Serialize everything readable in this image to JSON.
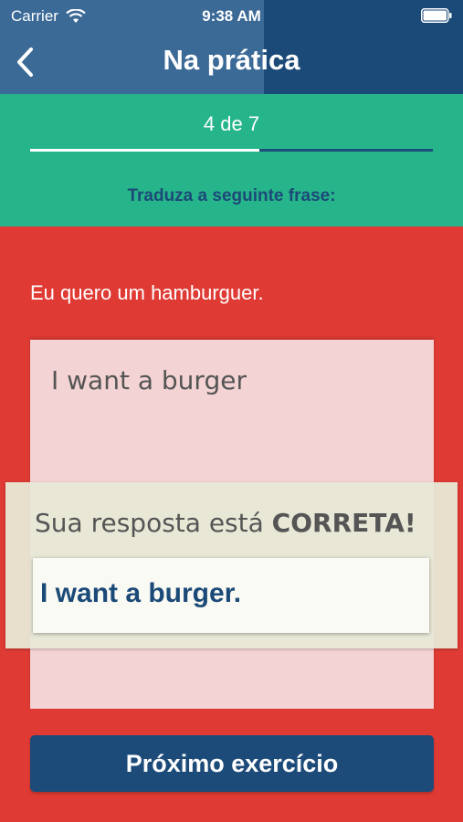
{
  "status_bar": {
    "carrier": "Carrier",
    "time": "9:38 AM"
  },
  "nav": {
    "title": "Na prática",
    "back_icon": "chevron-left-icon"
  },
  "progress": {
    "label": "4 de 7",
    "current": 4,
    "total": 7,
    "fill_fraction": 0.57
  },
  "exercise": {
    "instruction": "Traduza a seguinte frase:",
    "prompt": "Eu quero um hamburguer.",
    "user_answer": "I want a burger"
  },
  "feedback": {
    "message_prefix": "Sua resposta está ",
    "message_status": "CORRETA!",
    "correct_answer": "I want a burger."
  },
  "actions": {
    "next_label": "Próximo exercício"
  },
  "colors": {
    "nav_bg": "#3b6a97",
    "nav_dark": "#1c4a78",
    "header_green": "#26b58a",
    "body_red": "#df3a34",
    "button_blue": "#1d4b79"
  }
}
